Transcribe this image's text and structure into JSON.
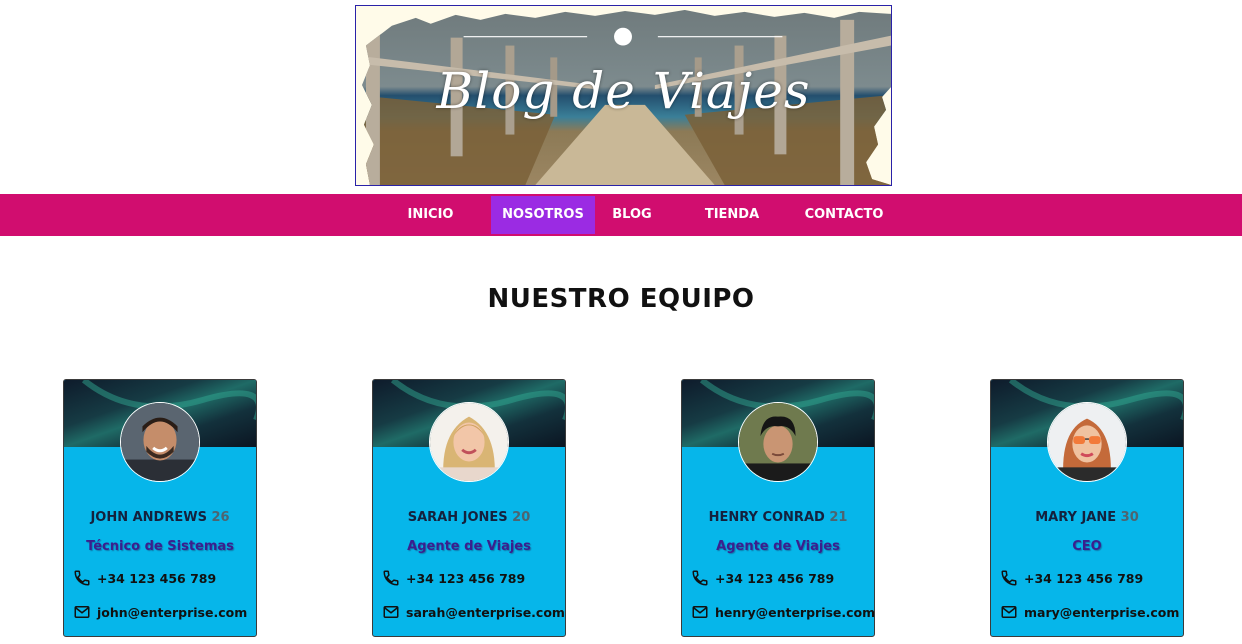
{
  "banner": {
    "title": "Blog de Viajes",
    "colors": {
      "border": "#2a22a8",
      "paper": "#fffbe9"
    }
  },
  "nav": {
    "items": [
      "INICIO",
      "NOSOTROS",
      "BLOG",
      "TIENDA",
      "CONTACTO"
    ],
    "active": "NOSOTROS",
    "colors": {
      "bar": "#d10d6f",
      "active": "#9b2be3"
    }
  },
  "section": {
    "title": "NUESTRO EQUIPO"
  },
  "team": [
    {
      "name": "JOHN ANDREWS",
      "age": "26",
      "role": "Técnico de Sistemas",
      "phone": "+34 123 456 789",
      "email": "john@enterprise.com",
      "avatar_icon": "man-beard-avatar"
    },
    {
      "name": "SARAH JONES",
      "age": "20",
      "role": "Agente de Viajes",
      "phone": "+34 123 456 789",
      "email": "sarah@enterprise.com",
      "avatar_icon": "blonde-woman-avatar"
    },
    {
      "name": "HENRY CONRAD",
      "age": "21",
      "role": "Agente de Viajes",
      "phone": "+34 123 456 789",
      "email": "henry@enterprise.com",
      "avatar_icon": "young-man-avatar"
    },
    {
      "name": "MARY JANE",
      "age": "30",
      "role": "CEO",
      "phone": "+34 123 456 789",
      "email": "mary@enterprise.com",
      "avatar_icon": "woman-sunglasses-avatar"
    }
  ],
  "colors": {
    "card": "#06b6ea",
    "role_text": "#3a1f8e"
  }
}
